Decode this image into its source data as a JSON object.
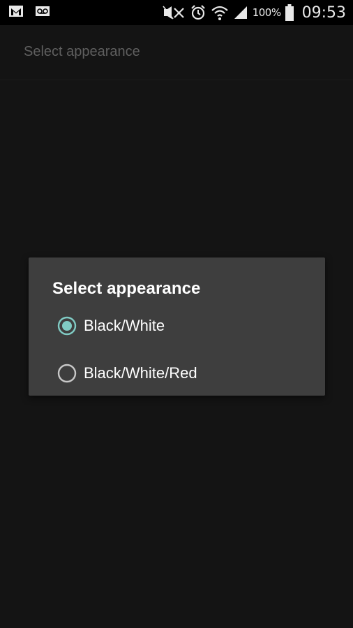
{
  "status_bar": {
    "icons_left": [
      "gmail-icon",
      "voicemail-icon"
    ],
    "icons_right": [
      "mute-icon",
      "alarm-icon",
      "wifi-icon",
      "signal-icon",
      "battery-icon"
    ],
    "battery_percent": "100%",
    "time": "09:53"
  },
  "page": {
    "title": "Select appearance"
  },
  "dialog": {
    "title": "Select appearance",
    "options": [
      {
        "label": "Black/White",
        "selected": true
      },
      {
        "label": "Black/White/Red",
        "selected": false
      }
    ]
  },
  "colors": {
    "accent": "#80cbc4",
    "dialog_bg": "#3e3e3e",
    "screen_bg": "#141414",
    "dim_text": "#5f5f5f"
  }
}
